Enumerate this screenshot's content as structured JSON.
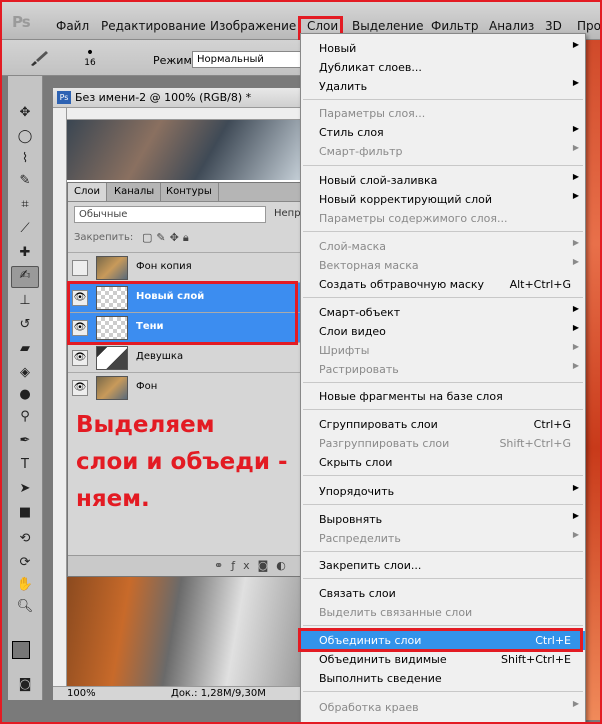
{
  "app_logo": "Ps",
  "menubar": {
    "items": [
      "Файл",
      "Редактирование",
      "Изображение",
      "Слои",
      "Выделение",
      "Фильтр",
      "Анализ",
      "3D",
      "Про"
    ]
  },
  "options_bar": {
    "brush_size": "16",
    "mode_label": "Режим:",
    "mode_value": "Нормальный"
  },
  "document": {
    "title": "Без имени-2 @ 100% (RGB/8) *",
    "zoom": "100%",
    "doc_size": "Док.: 1,28M/9,30M"
  },
  "layers_panel": {
    "tabs": [
      "Слои",
      "Каналы",
      "Контуры"
    ],
    "blend_mode": "Обычные",
    "opacity_label": "Непро",
    "lock_label": "Закрепить:",
    "layers": [
      {
        "name": "Фон копия",
        "selected": false,
        "visible": false,
        "thumb": "photo"
      },
      {
        "name": "Новый слой",
        "selected": true,
        "visible": true,
        "thumb": "trans"
      },
      {
        "name": "Тени",
        "selected": true,
        "visible": true,
        "thumb": "trans"
      },
      {
        "name": "Девушка",
        "selected": false,
        "visible": true,
        "thumb": "girl"
      },
      {
        "name": "Фон",
        "selected": false,
        "visible": true,
        "thumb": "photo"
      }
    ]
  },
  "instruction": {
    "line1": "Выделяем",
    "line2": "слои и объеди -",
    "line3": "няем."
  },
  "layer_menu": {
    "items": [
      {
        "label": "Новый",
        "arrow": true
      },
      {
        "label": "Дубликат слоев...",
        "arrow": false
      },
      {
        "label": "Удалить",
        "arrow": true
      },
      {
        "label": "Параметры слоя...",
        "disabled": true
      },
      {
        "label": "Стиль слоя",
        "arrow": true
      },
      {
        "label": "Смарт-фильтр",
        "arrow": true,
        "disabled": true
      },
      {
        "label": "Новый слой-заливка",
        "arrow": true
      },
      {
        "label": "Новый корректирующий слой",
        "arrow": true
      },
      {
        "label": "Параметры содержимого слоя...",
        "disabled": true
      },
      {
        "label": "Слой-маска",
        "arrow": true,
        "disabled": true
      },
      {
        "label": "Векторная маска",
        "arrow": true,
        "disabled": true
      },
      {
        "label": "Создать обтравочную маску",
        "shortcut": "Alt+Ctrl+G"
      },
      {
        "label": "Смарт-объект",
        "arrow": true
      },
      {
        "label": "Слои видео",
        "arrow": true
      },
      {
        "label": "Шрифты",
        "arrow": true,
        "disabled": true
      },
      {
        "label": "Растрировать",
        "arrow": true,
        "disabled": true
      },
      {
        "label": "Новые фрагменты на базе слоя"
      },
      {
        "label": "Сгруппировать слои",
        "shortcut": "Ctrl+G"
      },
      {
        "label": "Разгруппировать слои",
        "shortcut": "Shift+Ctrl+G",
        "disabled": true
      },
      {
        "label": "Скрыть слои"
      },
      {
        "label": "Упорядочить",
        "arrow": true
      },
      {
        "label": "Выровнять",
        "arrow": true
      },
      {
        "label": "Распределить",
        "arrow": true,
        "disabled": true
      },
      {
        "label": "Закрепить слои..."
      },
      {
        "label": "Связать слои"
      },
      {
        "label": "Выделить связанные слои",
        "disabled": true
      },
      {
        "label": "Объединить слои",
        "shortcut": "Ctrl+E",
        "highlighted": true
      },
      {
        "label": "Объединить видимые",
        "shortcut": "Shift+Ctrl+E"
      },
      {
        "label": "Выполнить сведение"
      },
      {
        "label": "Обработка краев",
        "arrow": true,
        "disabled": true
      }
    ]
  },
  "colors": {
    "accent": "#e31b23",
    "highlight": "#3393ea",
    "layer_selected": "#3c8df0"
  }
}
